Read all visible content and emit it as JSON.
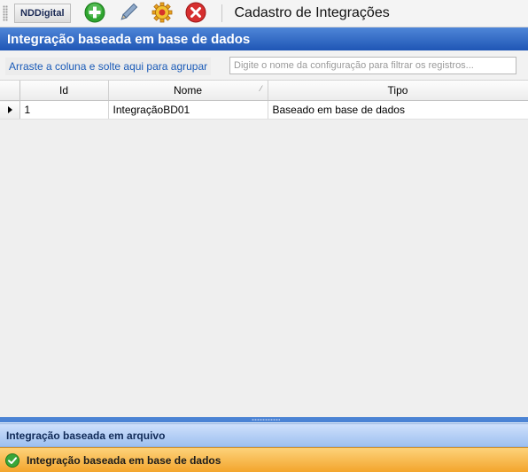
{
  "toolbar": {
    "brand": "NDDigital",
    "buttons": [
      {
        "icon": "add-icon",
        "color": "#2fa52f"
      },
      {
        "icon": "pencil-icon",
        "color": "#5a7ca6"
      },
      {
        "icon": "settings-gear-icon",
        "color": "#e9a21c"
      },
      {
        "icon": "close-icon",
        "color": "#d62f2f"
      }
    ],
    "title": "Cadastro de Integrações"
  },
  "section": {
    "title": "Integração baseada em base de dados"
  },
  "group_bar": {
    "group_label": "Arraste a coluna e solte aqui para agrupar",
    "filter_placeholder": "Digite o nome da configuração para filtrar os registros..."
  },
  "grid": {
    "columns": [
      "Id",
      "Nome",
      "Tipo"
    ],
    "rows": [
      {
        "id": "1",
        "nome": "IntegraçãoBD01",
        "tipo": "Baseado em base de dados"
      }
    ]
  },
  "navigation": {
    "items": [
      {
        "label": "Integração baseada em arquivo",
        "active": false
      },
      {
        "label": "Integração baseada em base de dados",
        "active": true
      }
    ]
  },
  "colors": {
    "header_blue": "#1f56b5",
    "active_nav": "#f3a52c",
    "inactive_nav": "#9ec0f0",
    "link_blue": "#1a5bb8"
  }
}
